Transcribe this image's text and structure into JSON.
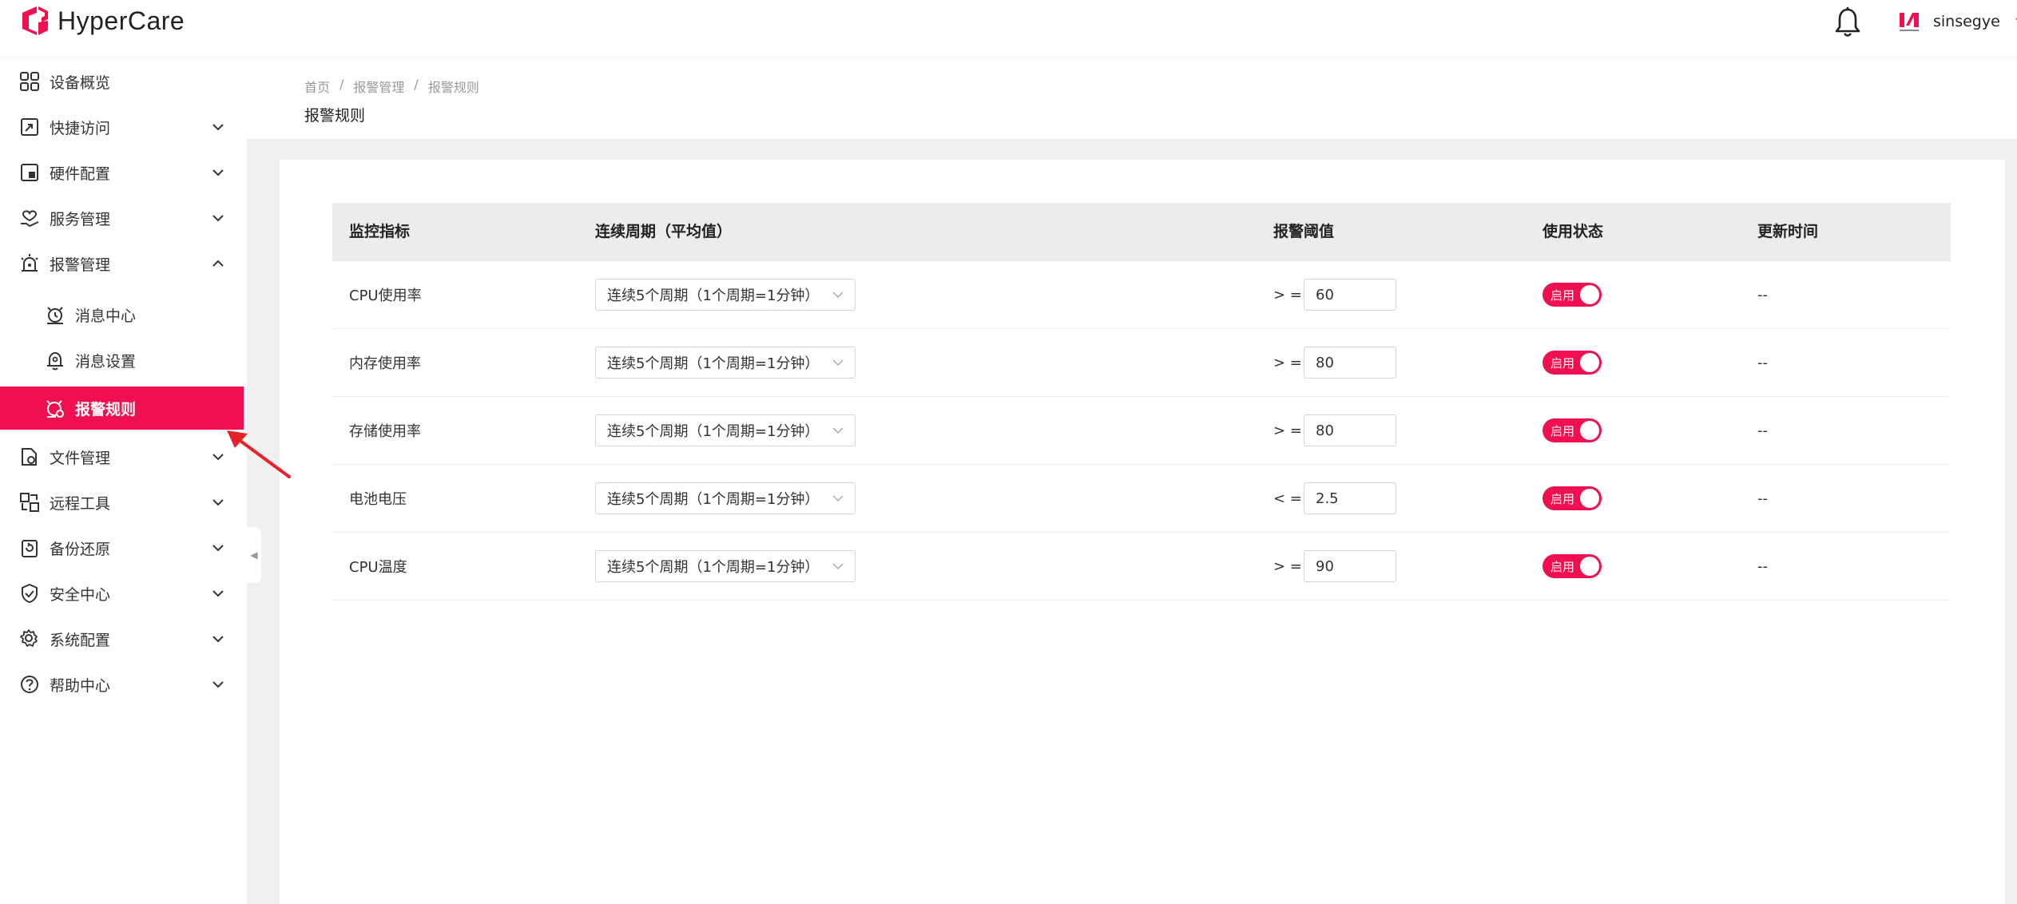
{
  "app": {
    "name": "HyperCare",
    "brand_color": "#f0104f",
    "user_name": "sinsegye"
  },
  "sidebar": {
    "items": [
      {
        "label": "设备概览",
        "icon": "grid-icon",
        "has_chevron": false
      },
      {
        "label": "快捷访问",
        "icon": "shortcut-icon",
        "has_chevron": true
      },
      {
        "label": "硬件配置",
        "icon": "hardware-icon",
        "has_chevron": true
      },
      {
        "label": "服务管理",
        "icon": "service-icon",
        "has_chevron": true
      },
      {
        "label": "报警管理",
        "icon": "alarm-icon",
        "has_chevron": true,
        "expanded": true,
        "children": [
          {
            "label": "消息中心",
            "icon": "message-center-icon"
          },
          {
            "label": "消息设置",
            "icon": "message-settings-icon"
          },
          {
            "label": "报警规则",
            "icon": "alarm-rule-icon",
            "active": true
          }
        ]
      },
      {
        "label": "文件管理",
        "icon": "file-icon",
        "has_chevron": true
      },
      {
        "label": "远程工具",
        "icon": "remote-icon",
        "has_chevron": true
      },
      {
        "label": "备份还原",
        "icon": "backup-icon",
        "has_chevron": true
      },
      {
        "label": "安全中心",
        "icon": "shield-icon",
        "has_chevron": true
      },
      {
        "label": "系统配置",
        "icon": "gear-icon",
        "has_chevron": true
      },
      {
        "label": "帮助中心",
        "icon": "help-icon",
        "has_chevron": true
      }
    ]
  },
  "breadcrumb": [
    "首页",
    "报警管理",
    "报警规则"
  ],
  "page_title": "报警规则",
  "table": {
    "headers": [
      "监控指标",
      "连续周期（平均值）",
      "报警阈值",
      "使用状态",
      "更新时间"
    ],
    "rows": [
      {
        "metric": "CPU使用率",
        "period": "连续5个周期（1个周期=1分钟）",
        "op": "> =",
        "threshold": "60",
        "status": "启用",
        "updated": "--"
      },
      {
        "metric": "内存使用率",
        "period": "连续5个周期（1个周期=1分钟）",
        "op": "> =",
        "threshold": "80",
        "status": "启用",
        "updated": "--"
      },
      {
        "metric": "存储使用率",
        "period": "连续5个周期（1个周期=1分钟）",
        "op": "> =",
        "threshold": "80",
        "status": "启用",
        "updated": "--"
      },
      {
        "metric": "电池电压",
        "period": "连续5个周期（1个周期=1分钟）",
        "op": "< =",
        "threshold": "2.5",
        "status": "启用",
        "updated": "--"
      },
      {
        "metric": "CPU温度",
        "period": "连续5个周期（1个周期=1分钟）",
        "op": "> =",
        "threshold": "90",
        "status": "启用",
        "updated": "--"
      }
    ]
  }
}
